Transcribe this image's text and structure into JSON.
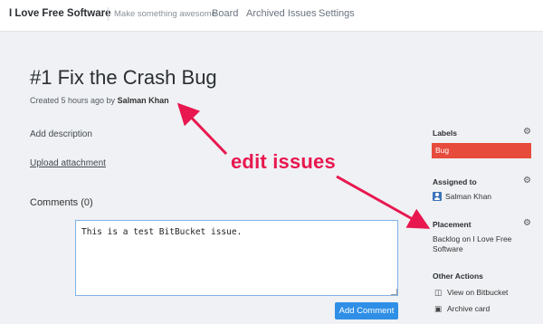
{
  "nav": {
    "brand": "I Love Free Software",
    "tagline": "Make something awesome",
    "links": [
      "Board",
      "Archived Issues",
      "Settings"
    ]
  },
  "issue": {
    "title": "#1 Fix the Crash Bug",
    "created": "Created 5 hours ago by",
    "author": "Salman Khan",
    "add_description": "Add description",
    "upload_attachment": "Upload attachment",
    "comments_heading": "Comments (0)",
    "comment_value": "This is a test BitBucket issue.",
    "add_comment_label": "Add Comment"
  },
  "sidebar": {
    "labels_heading": "Labels",
    "label_value": "Bug",
    "assigned_heading": "Assigned to",
    "assignee": "Salman Khan",
    "placement_heading": "Placement",
    "placement_value": "Backlog on I Love Free Software",
    "other_actions_heading": "Other Actions",
    "actions": [
      "View on Bitbucket",
      "Archive card"
    ]
  },
  "annotation": {
    "text": "edit issues",
    "color": "#e8174f"
  },
  "colors": {
    "background": "#eff1f4",
    "label_bug": "#e64b3c",
    "button": "#2f8fe6"
  },
  "icons": [
    "gear-icon",
    "user-icon",
    "bitbucket-icon",
    "archive-icon"
  ]
}
